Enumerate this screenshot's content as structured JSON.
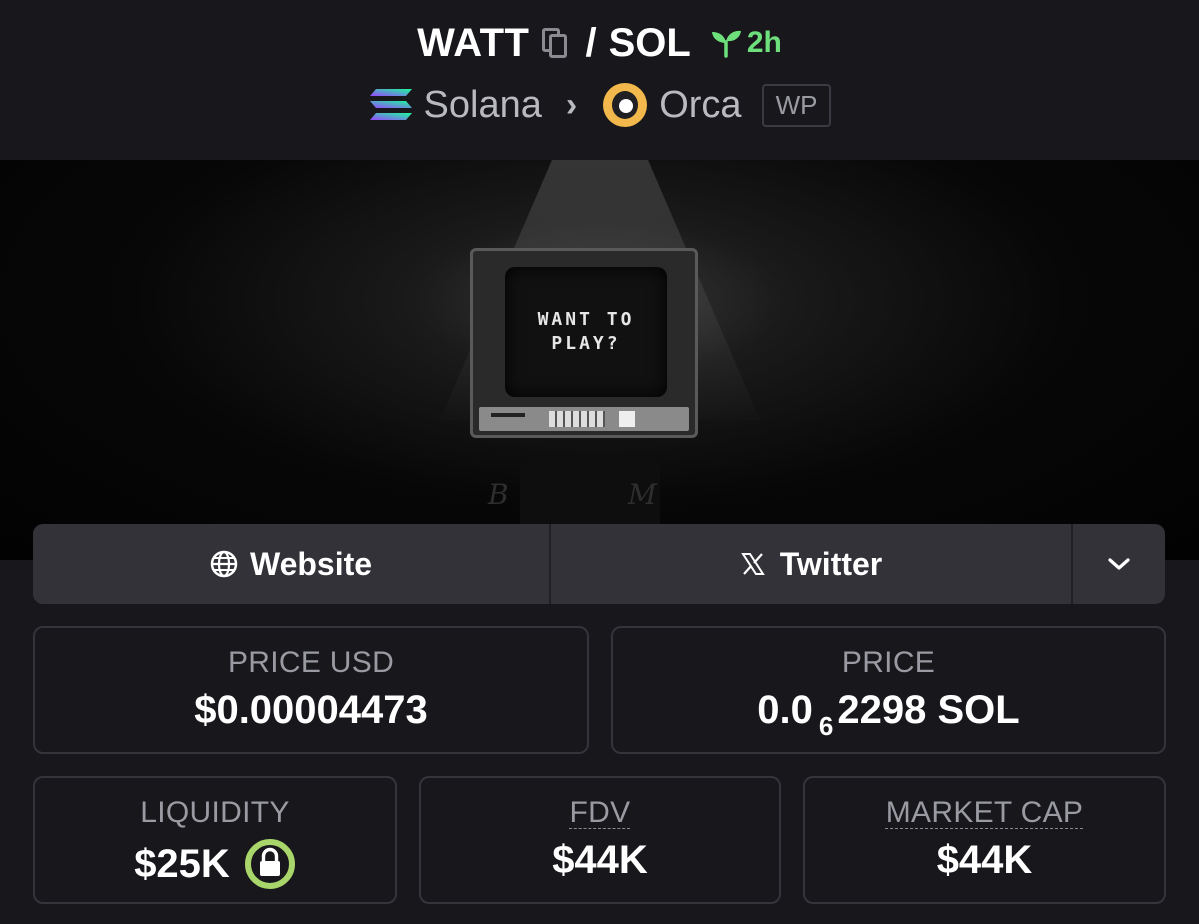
{
  "header": {
    "base_token": "WATT",
    "separator": "/",
    "quote_token": "SOL",
    "age": "2h",
    "chain": "Solana",
    "dex": "Orca",
    "badge": "WP"
  },
  "banner": {
    "screen_text_line1": "WANT TO",
    "screen_text_line2": "PLAY?"
  },
  "links": {
    "website_label": "Website",
    "twitter_label": "Twitter"
  },
  "stats": {
    "price_usd_label": "PRICE USD",
    "price_usd_value": "$0.00004473",
    "price_label": "PRICE",
    "price_prefix": "0.0",
    "price_zero_count": "6",
    "price_digits": "2298 SOL",
    "liquidity_label": "LIQUIDITY",
    "liquidity_value": "$25K",
    "fdv_label": "FDV",
    "fdv_value": "$44K",
    "mcap_label": "MARKET CAP",
    "mcap_value": "$44K"
  },
  "colors": {
    "background": "#17171c",
    "age_green": "#6ee07b",
    "lock_green": "#a8d66a",
    "orca_gold": "#f2b84b"
  },
  "icons": [
    "copy-icon",
    "sprout-icon",
    "solana-icon",
    "orca-icon",
    "globe-icon",
    "x-icon",
    "chevron-down-icon",
    "lock-icon"
  ]
}
